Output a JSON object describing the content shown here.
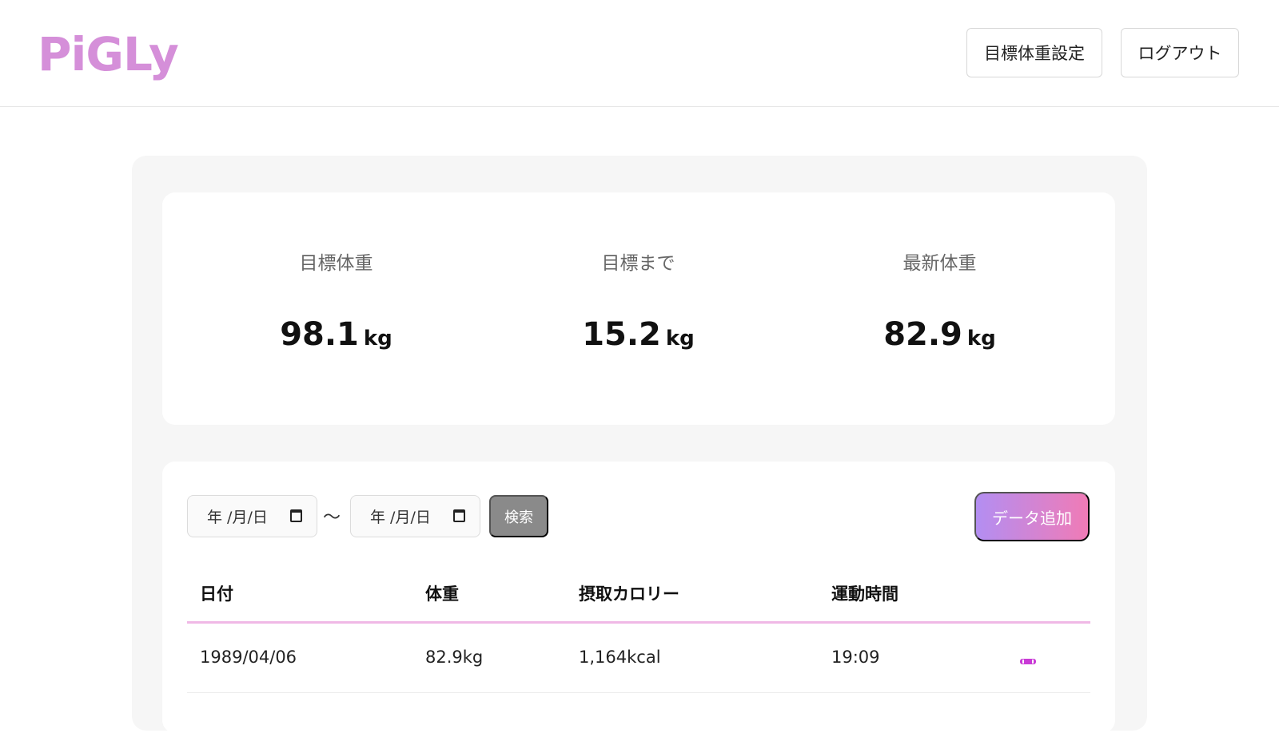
{
  "header": {
    "logo": "PiGLy",
    "goal_weight_button": "目標体重設定",
    "logout_button": "ログアウト"
  },
  "summary": {
    "goal_weight": {
      "label": "目標体重",
      "value": "98.1",
      "unit": "kg"
    },
    "to_goal": {
      "label": "目標まで",
      "value": "15.2",
      "unit": "kg"
    },
    "latest_weight": {
      "label": "最新体重",
      "value": "82.9",
      "unit": "kg"
    }
  },
  "filter": {
    "from_placeholder": "年 /月/日",
    "to_placeholder": "年 /月/日",
    "separator": "〜",
    "search_button": "検索",
    "add_button": "データ追加"
  },
  "table": {
    "columns": [
      "日付",
      "体重",
      "摂取カロリー",
      "運動時間"
    ],
    "rows": [
      {
        "date": "1989/04/06",
        "weight": "82.9kg",
        "calories": "1,164kcal",
        "exercise": "19:09"
      }
    ]
  },
  "colors": {
    "logo": "#d58fd9",
    "accent_gradient_start": "#b38ef2",
    "accent_gradient_end": "#f07bb6",
    "edit_icon": "#c93ad6"
  }
}
